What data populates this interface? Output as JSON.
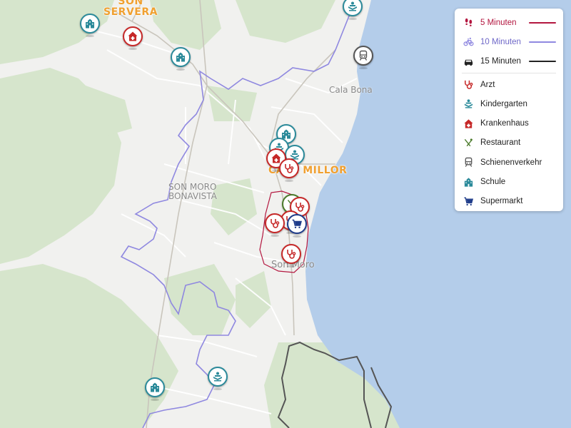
{
  "map": {
    "place_labels": {
      "son_servera": "SON\nSERVERA",
      "cala_bona": "Cala Bona",
      "cala_millor": "CALA MILLOR",
      "son_moro_bonavista": "SON MORO\nBONAVISTA",
      "son_moro": "Son Moro"
    },
    "colors": {
      "water": "#b4cdea",
      "land": "#f1f1ef",
      "green": "#d6e5cc",
      "five_min": "#b3163f",
      "ten_min": "#8f88e0",
      "fifteen_min": "#444444",
      "arzt": "#c62828",
      "kindergarten": "#2b8a9a",
      "krankenhaus": "#c62828",
      "restaurant": "#4a7a2a",
      "schienenverkehr": "#555555",
      "schule": "#2b8a9a",
      "supermarkt": "#1f3c8a"
    },
    "markers": [
      {
        "category": "schule",
        "icon": "school-icon"
      },
      {
        "category": "krankenhaus",
        "icon": "hospital-icon"
      },
      {
        "category": "schule",
        "icon": "school-icon"
      },
      {
        "category": "kindergarten",
        "icon": "kindergarten-icon"
      },
      {
        "category": "schienenverkehr",
        "icon": "train-icon"
      },
      {
        "category": "schule",
        "icon": "school-icon"
      },
      {
        "category": "kindergarten",
        "icon": "kindergarten-icon"
      },
      {
        "category": "kindergarten",
        "icon": "kindergarten-icon"
      },
      {
        "category": "krankenhaus",
        "icon": "hospital-icon"
      },
      {
        "category": "arzt",
        "icon": "stethoscope-icon"
      },
      {
        "category": "restaurant",
        "icon": "restaurant-icon"
      },
      {
        "category": "arzt",
        "icon": "stethoscope-icon"
      },
      {
        "category": "arzt",
        "icon": "stethoscope-icon"
      },
      {
        "category": "supermarkt",
        "icon": "cart-icon"
      },
      {
        "category": "arzt",
        "icon": "stethoscope-icon"
      },
      {
        "category": "arzt",
        "icon": "stethoscope-icon"
      },
      {
        "category": "kindergarten",
        "icon": "kindergarten-icon"
      },
      {
        "category": "schule",
        "icon": "school-icon"
      }
    ]
  },
  "legend": {
    "isochrones": [
      {
        "label": "5 Minuten",
        "color": "#b3163f",
        "text_color": "#b3163f",
        "icon": "footsteps-icon"
      },
      {
        "label": "10 Minuten",
        "color": "#8f88e0",
        "text_color": "#6f68c8",
        "icon": "bicycle-icon"
      },
      {
        "label": "15 Minuten",
        "color": "#222222",
        "text_color": "#222222",
        "icon": "car-icon"
      }
    ],
    "categories": [
      {
        "label": "Arzt",
        "icon": "stethoscope-icon",
        "color": "#c62828"
      },
      {
        "label": "Kindergarten",
        "icon": "kindergarten-icon",
        "color": "#2b8a9a"
      },
      {
        "label": "Krankenhaus",
        "icon": "hospital-icon",
        "color": "#c62828"
      },
      {
        "label": "Restaurant",
        "icon": "restaurant-icon",
        "color": "#4a7a2a"
      },
      {
        "label": "Schienenverkehr",
        "icon": "train-icon",
        "color": "#555555"
      },
      {
        "label": "Schule",
        "icon": "school-icon",
        "color": "#2b8a9a"
      },
      {
        "label": "Supermarkt",
        "icon": "cart-icon",
        "color": "#1f3c8a"
      }
    ]
  }
}
